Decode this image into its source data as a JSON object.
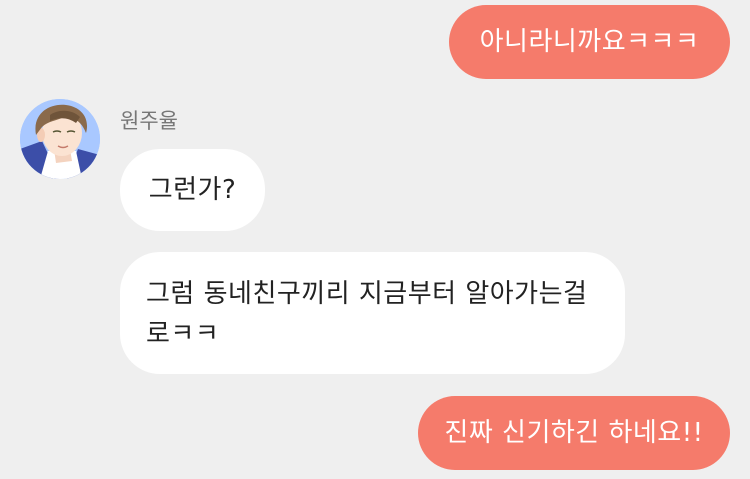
{
  "conversation": {
    "sender": {
      "name": "원주율",
      "avatar_icon": "boy-portrait-avatar"
    },
    "messages": [
      {
        "direction": "outgoing",
        "text": "아니라니까요ㅋㅋㅋ"
      },
      {
        "direction": "incoming",
        "text": "그런가?"
      },
      {
        "direction": "incoming",
        "text": "그럼 동네친구끼리 지금부터 알아가는걸로ㅋㅋ"
      },
      {
        "direction": "outgoing",
        "text": "진짜 신기하긴 하네요!!"
      }
    ]
  },
  "colors": {
    "background": "#efefef",
    "outgoing_bubble": "#f57b6b",
    "incoming_bubble": "#ffffff",
    "sender_name": "#777777"
  }
}
